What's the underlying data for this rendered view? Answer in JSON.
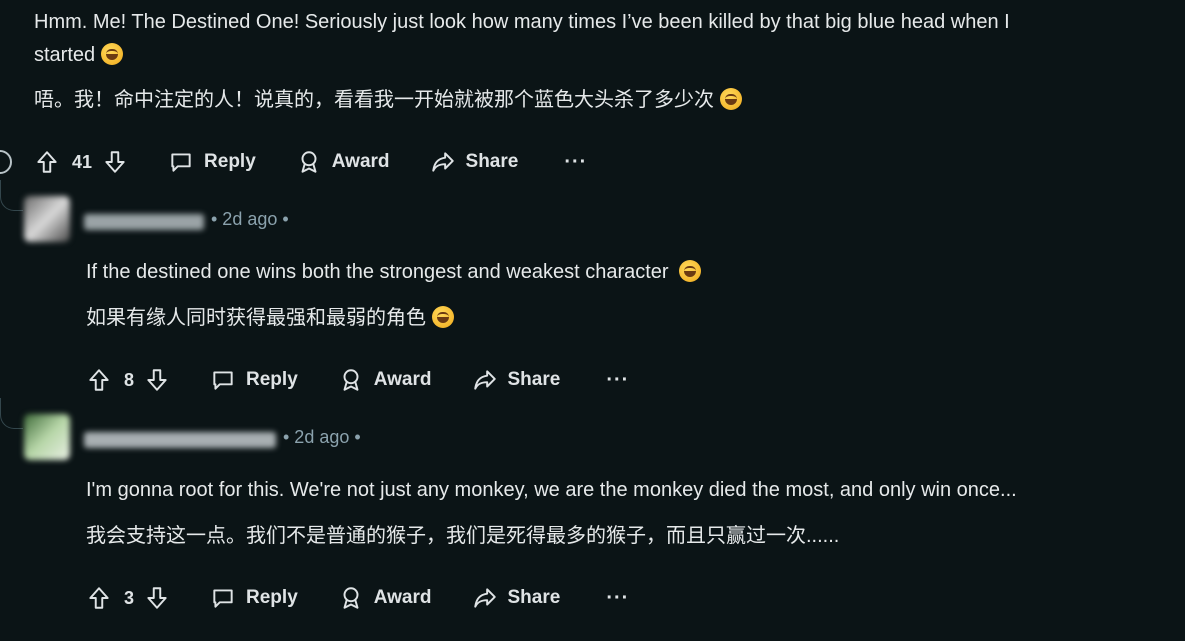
{
  "top_comment": {
    "text_en_1": "Hmm. Me! The Destined One! Seriously just look how many times I’ve been killed by that big blue head when I",
    "text_en_2": "started",
    "text_zh": "唔。我！命中注定的人！说真的，看看我一开始就被那个蓝色大头杀了多少次",
    "votes": "41"
  },
  "replies": [
    {
      "time": "• 2d ago •",
      "text_en": "If the destined one wins both the strongest and weakest character",
      "text_zh": "如果有缘人同时获得最强和最弱的角色",
      "votes": "8"
    },
    {
      "time": "• 2d ago •",
      "text_en": "I'm gonna root for this. We're not just any monkey, we are the monkey died the most, and only win once...",
      "text_zh": "我会支持这一点。我们不是普通的猴子，我们是死得最多的猴子，而且只赢过一次......",
      "votes": "3"
    }
  ],
  "actions": {
    "reply": "Reply",
    "award": "Award",
    "share": "Share",
    "more": "···"
  },
  "icons": {
    "upvote": "upvote-arrow-icon",
    "downvote": "downvote-arrow-icon",
    "reply": "speech-bubble-icon",
    "award": "award-ribbon-icon",
    "share": "share-arrow-icon",
    "emoji": "rolling-laughing-emoji"
  },
  "colors": {
    "background": "#0b1416",
    "text": "#e6e9ea",
    "meta": "#8ba2ad"
  }
}
